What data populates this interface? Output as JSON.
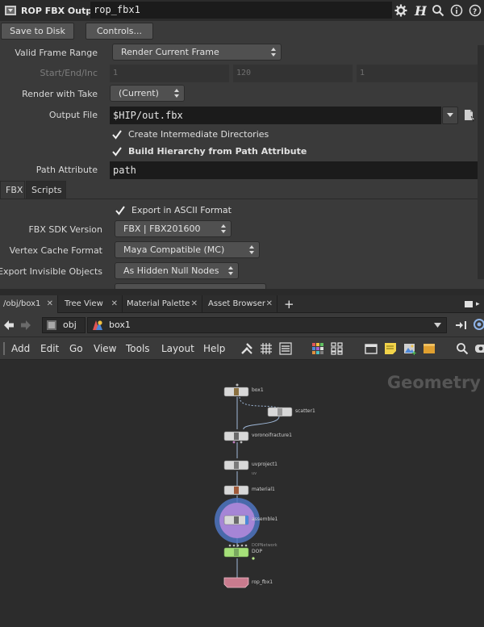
{
  "header": {
    "node_type": "ROP FBX Output",
    "node_name": "rop_fbx1",
    "icons": [
      "gear-icon",
      "houdini-h-icon",
      "search-icon",
      "info-icon",
      "help-icon"
    ]
  },
  "params": {
    "save_to_disk": "Save to Disk",
    "controls": "Controls...",
    "valid_frame_range": {
      "label": "Valid Frame Range",
      "value": "Render Current Frame"
    },
    "start_end_inc": {
      "label": "Start/End/Inc",
      "start": "1",
      "end": "120",
      "inc": "1"
    },
    "render_with_take": {
      "label": "Render with Take",
      "value": "(Current)"
    },
    "output_file": {
      "label": "Output File",
      "value": "$HIP/out.fbx"
    },
    "create_dirs": "Create Intermediate Directories",
    "build_hierarchy": "Build Hierarchy from Path Attribute",
    "path_attribute": {
      "label": "Path Attribute",
      "value": "path"
    },
    "tabs": [
      "FBX",
      "Scripts"
    ],
    "export_ascii": "Export in ASCII Format",
    "fbx_sdk_version": {
      "label": "FBX SDK Version",
      "value": "FBX | FBX201600"
    },
    "vertex_cache_format": {
      "label": "Vertex Cache Format",
      "value": "Maya Compatible (MC)"
    },
    "export_invisible": {
      "label": "Export Invisible Objects",
      "value": "As Hidden Null Nodes"
    }
  },
  "pane_tabs": [
    "/obj/box1",
    "Tree View",
    "Material Palette",
    "Asset Browser"
  ],
  "path": {
    "root": "obj",
    "current": "box1"
  },
  "menu": [
    "Add",
    "Edit",
    "Go",
    "View",
    "Tools",
    "Layout",
    "Help"
  ],
  "network": {
    "watermark": "Geometry",
    "nodes": [
      {
        "name": "box1",
        "color": "#d8d8d8"
      },
      {
        "name": "scatter1",
        "color": "#d8d8d8"
      },
      {
        "name": "voronoifracture1",
        "color": "#d8d8d8"
      },
      {
        "name": "uvproject1",
        "sub": "uv",
        "color": "#d8d8d8"
      },
      {
        "name": "material1",
        "color": "#d8d8d8"
      },
      {
        "name": "assemble1",
        "color": "#d8d8d8"
      },
      {
        "name": "DOP",
        "sub": "DOPNetwork",
        "color": "#a6e07a"
      },
      {
        "name": "rop_fbx1",
        "color": "#c97b8e"
      }
    ]
  },
  "colors": {
    "panel": "#3a3a3a",
    "field": "#1b1b1b",
    "network_bg": "#2c2c2c",
    "highlight_ring": "#5b86d6",
    "selected_node": "#a685d6"
  }
}
